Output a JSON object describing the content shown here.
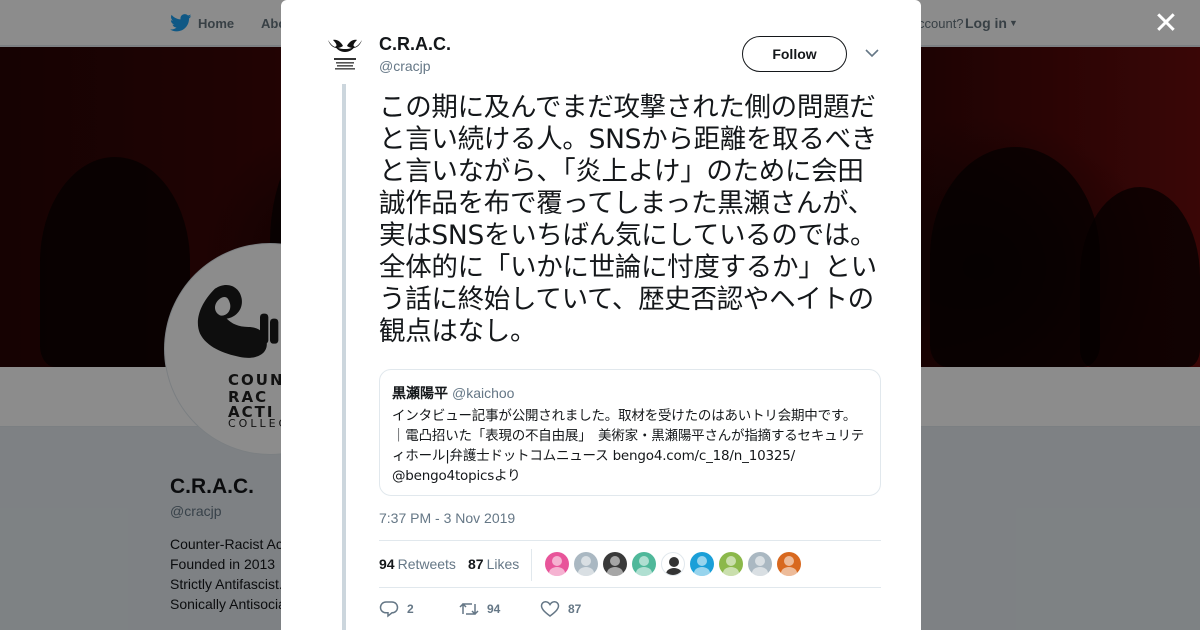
{
  "background": {
    "nav": {
      "home_label": "Home",
      "about_label": "Abo",
      "account_text": "ccount?",
      "login_label": "Log in"
    },
    "profile": {
      "avatar_text_lines": [
        "COUN",
        "RAC",
        "ACTI",
        "COLLEC"
      ],
      "name": "C.R.A.C.",
      "handle": "@cracjp",
      "bio_lines": [
        "Counter-Racist Ac",
        "Founded in 2013",
        "Strictly Antifascist.",
        "Sonically Antisocia"
      ]
    }
  },
  "modal": {
    "close_glyph": "✕",
    "author": {
      "name": "C.R.A.C.",
      "handle": "@cracjp"
    },
    "follow_label": "Follow",
    "tweet_text": "この期に及んでまだ攻撃された側の問題だと言い続ける人。SNSから距離を取るべきと言いながら、「炎上よけ」のために会田誠作品を布で覆ってしまった黒瀬さんが、実はSNSをいちばん気にしているのでは。全体的に「いかに世論に忖度するか」という話に終始していて、歴史否認やヘイトの観点はなし。",
    "quote": {
      "name": "黒瀬陽平",
      "handle": "@kaichoo",
      "text": "インタビュー記事が公開されました。取材を受けたのはあいトリ会期中です。｜電凸招いた「表現の不自由展」　美術家・黒瀬陽平さんが指摘するセキュリティホール|弁護士ドットコムニュース bengo4.com/c_18/n_10325/ @bengo4topicsより"
    },
    "timestamp": "7:37 PM - 3 Nov 2019",
    "stats": {
      "retweets_count": "94",
      "retweets_label": "Retweets",
      "likes_count": "87",
      "likes_label": "Likes"
    },
    "actions": {
      "reply_count": "2",
      "retweet_count": "94",
      "like_count": "87"
    },
    "liker_colors": [
      "#e8559a",
      "#aab8c2",
      "#3a3a3a",
      "#4fb89a",
      "#ffffff",
      "#1a9fd8",
      "#8bb84a",
      "#aab8c2",
      "#d8681e"
    ],
    "colors": {
      "accent": "#1da1f2",
      "text": "#14171a",
      "muted": "#657786",
      "border": "#e1e8ed"
    }
  }
}
